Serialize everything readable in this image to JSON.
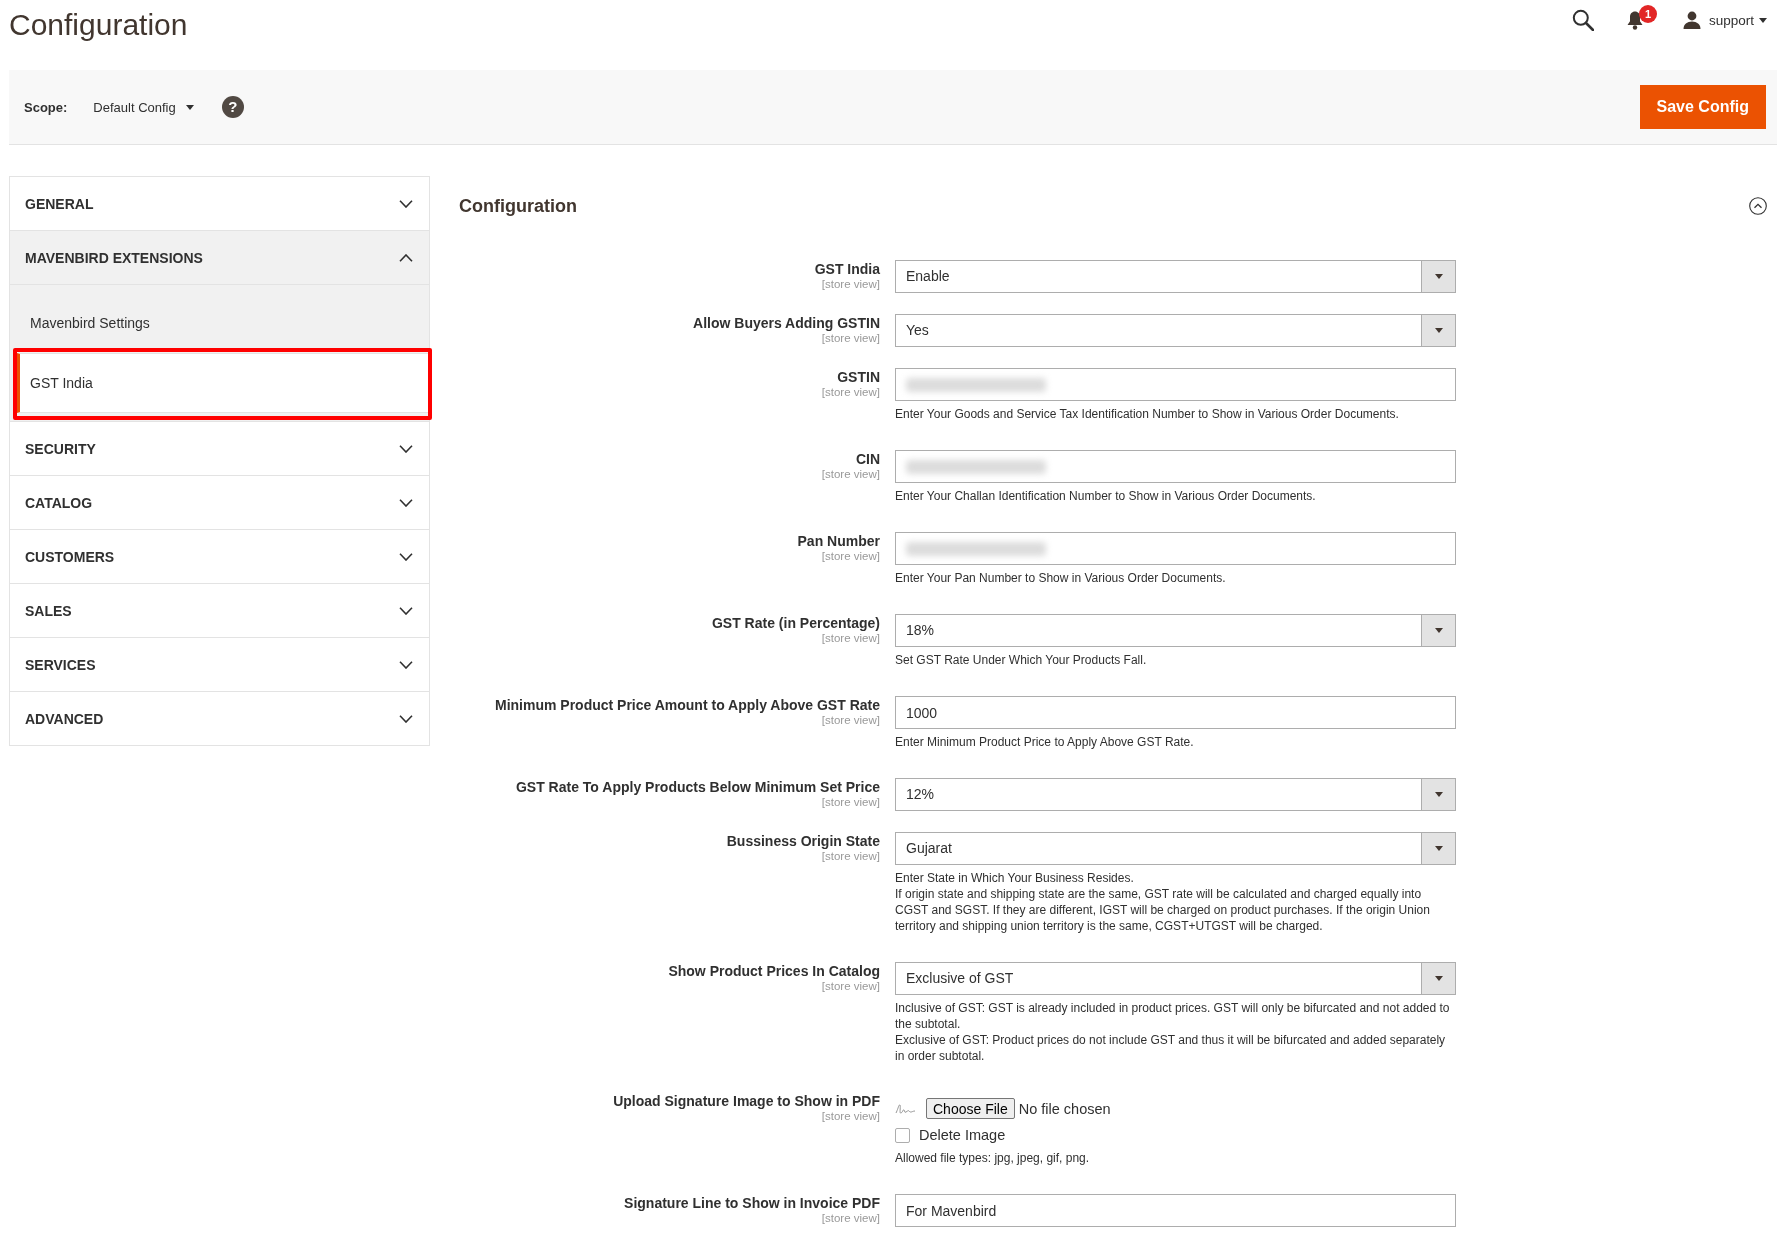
{
  "header": {
    "title": "Configuration",
    "notifications": {
      "count": "1"
    },
    "user": {
      "name": "support"
    }
  },
  "scope_bar": {
    "label": "Scope:",
    "value": "Default Config",
    "help": "?",
    "save_button": "Save Config"
  },
  "sidebar": {
    "groups": [
      {
        "label": "GENERAL",
        "expanded": false
      },
      {
        "label": "MAVENBIRD EXTENSIONS",
        "expanded": true,
        "children": [
          {
            "label": "Mavenbird Settings",
            "selected": false,
            "highlighted": false
          },
          {
            "label": "GST India",
            "selected": true,
            "highlighted": true
          }
        ]
      },
      {
        "label": "SECURITY",
        "expanded": false
      },
      {
        "label": "CATALOG",
        "expanded": false
      },
      {
        "label": "CUSTOMERS",
        "expanded": false
      },
      {
        "label": "SALES",
        "expanded": false
      },
      {
        "label": "SERVICES",
        "expanded": false
      },
      {
        "label": "ADVANCED",
        "expanded": false
      }
    ]
  },
  "section": {
    "title": "Configuration",
    "expanded": true,
    "fields": [
      {
        "kind": "select",
        "label": "GST India",
        "scope": "[store view]",
        "value": "Enable"
      },
      {
        "kind": "select",
        "label": "Allow Buyers Adding GSTIN",
        "scope": "[store view]",
        "value": "Yes"
      },
      {
        "kind": "text",
        "label": "GSTIN",
        "scope": "[store view]",
        "redacted": true,
        "note": [
          "Enter Your Goods and Service Tax Identification Number to Show in Various Order Documents."
        ]
      },
      {
        "kind": "text",
        "label": "CIN",
        "scope": "[store view]",
        "redacted": true,
        "note": [
          "Enter Your Challan Identification Number to Show in Various Order Documents."
        ]
      },
      {
        "kind": "text",
        "label": "Pan Number",
        "scope": "[store view]",
        "redacted": true,
        "note": [
          "Enter Your Pan Number to Show in Various Order Documents."
        ]
      },
      {
        "kind": "select",
        "label": "GST Rate (in Percentage)",
        "scope": "[store view]",
        "value": "18%",
        "note": [
          "Set GST Rate Under Which Your Products Fall."
        ]
      },
      {
        "kind": "text",
        "label": "Minimum Product Price Amount to Apply Above GST Rate",
        "scope": "[store view]",
        "redacted": false,
        "value": "1000",
        "note": [
          "Enter Minimum Product Price to Apply Above GST Rate."
        ]
      },
      {
        "kind": "select",
        "label": "GST Rate To Apply Products Below Minimum Set Price",
        "scope": "[store view]",
        "value": "12%"
      },
      {
        "kind": "select",
        "label": "Bussiness Origin State",
        "scope": "[store view]",
        "value": "Gujarat",
        "note": [
          "Enter State in Which Your Business Resides.",
          "If origin state and shipping state are the same, GST rate will be calculated and charged equally into CGST and SGST. If they are different, IGST will be charged on product purchases. If the origin Union territory and shipping union territory is the same, CGST+UTGST will be charged."
        ]
      },
      {
        "kind": "select",
        "label": "Show Product Prices In Catalog",
        "scope": "[store view]",
        "value": "Exclusive of GST",
        "note": [
          "Inclusive of GST: GST is already included in product prices. GST will only be bifurcated and not added to the subtotal.",
          "Exclusive of GST: Product prices do not include GST and thus it will be bifurcated and added separately in order subtotal."
        ]
      },
      {
        "kind": "file",
        "label": "Upload Signature Image to Show in PDF",
        "scope": "[store view]",
        "has_preview": true,
        "button": "Choose File",
        "status": "No file chosen",
        "delete_label": "Delete Image",
        "delete_checked": false,
        "note": [
          "Allowed file types: jpg, jpeg, gif, png."
        ]
      },
      {
        "kind": "text",
        "label": "Signature Line to Show in Invoice PDF",
        "scope": "[store view]",
        "redacted": false,
        "value": "For Mavenbird"
      }
    ]
  }
}
